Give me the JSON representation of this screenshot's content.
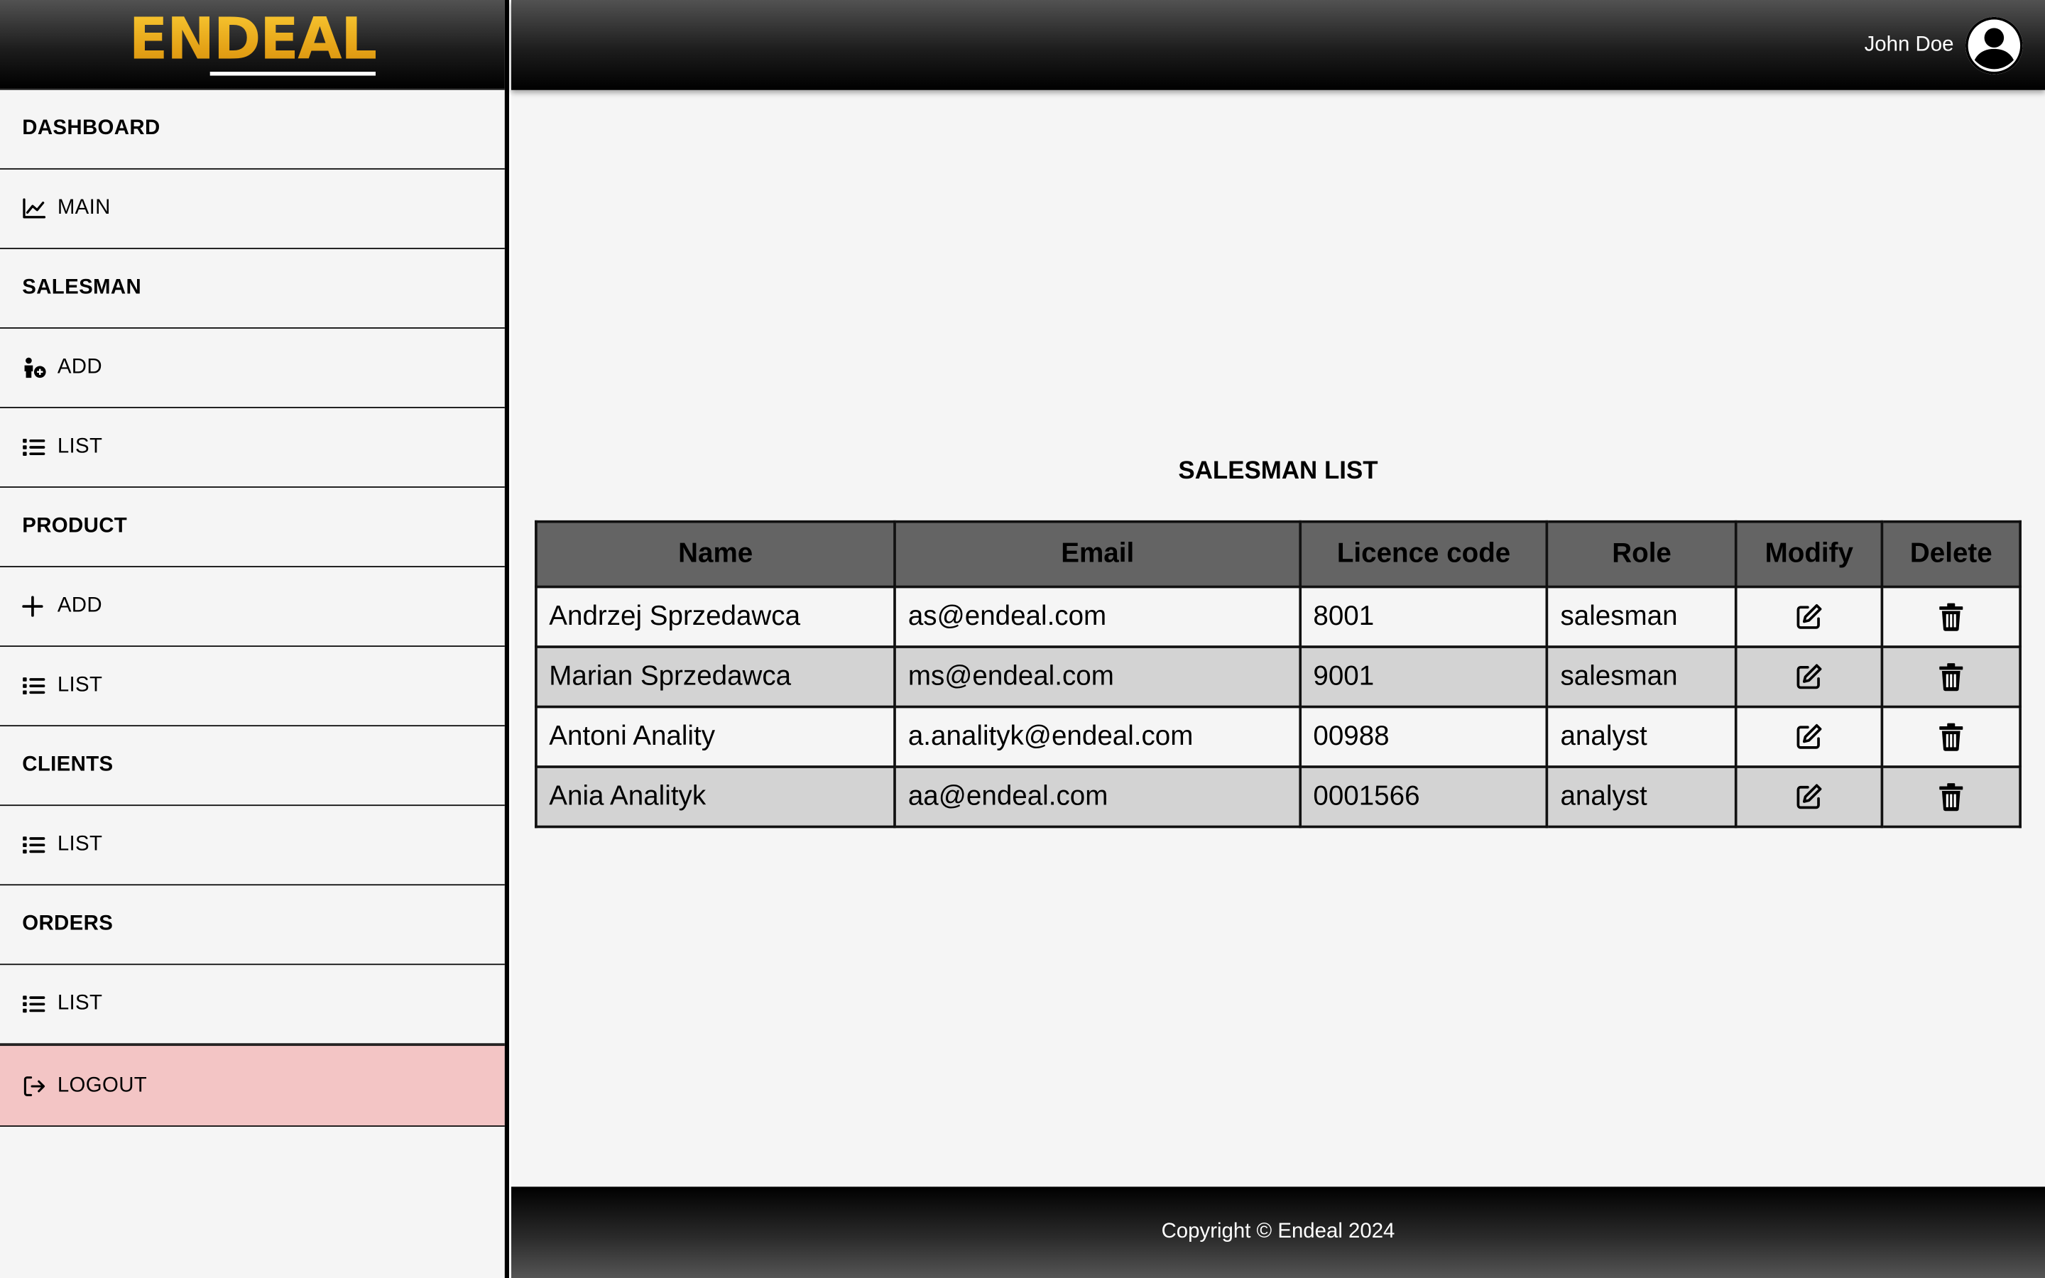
{
  "brand": {
    "logo_text": "ENDEAL"
  },
  "header": {
    "user_name": "John Doe"
  },
  "sidebar": {
    "items": [
      {
        "type": "header",
        "label": "DASHBOARD"
      },
      {
        "type": "link",
        "label": "MAIN",
        "icon": "chart-line-icon"
      },
      {
        "type": "header",
        "label": "SALESMAN"
      },
      {
        "type": "link",
        "label": "ADD",
        "icon": "user-add-icon"
      },
      {
        "type": "link",
        "label": "LIST",
        "icon": "list-icon"
      },
      {
        "type": "header",
        "label": "PRODUCT"
      },
      {
        "type": "link",
        "label": "ADD",
        "icon": "plus-icon"
      },
      {
        "type": "link",
        "label": "LIST",
        "icon": "list-icon"
      },
      {
        "type": "header",
        "label": "CLIENTS"
      },
      {
        "type": "link",
        "label": "LIST",
        "icon": "list-icon"
      },
      {
        "type": "header",
        "label": "ORDERS"
      },
      {
        "type": "link",
        "label": "LIST",
        "icon": "list-icon"
      }
    ],
    "logout_label": "LOGOUT",
    "logout_color": "#f3c5c5"
  },
  "main": {
    "title": "SALESMAN LIST",
    "table": {
      "columns": [
        "Name",
        "Email",
        "Licence code",
        "Role",
        "Modify",
        "Delete"
      ],
      "rows": [
        {
          "name": "Andrzej Sprzedawca",
          "email": "as@endeal.com",
          "licence": "8001",
          "role": "salesman"
        },
        {
          "name": "Marian Sprzedawca",
          "email": "ms@endeal.com",
          "licence": "9001",
          "role": "salesman"
        },
        {
          "name": "Antoni Anality",
          "email": "a.analityk@endeal.com",
          "licence": "00988",
          "role": "analyst"
        },
        {
          "name": "Ania Analityk",
          "email": "aa@endeal.com",
          "licence": "0001566",
          "role": "analyst"
        }
      ]
    }
  },
  "footer": {
    "copyright": "Copyright © Endeal 2024"
  },
  "colors": {
    "brand_gold": "#e8a81a",
    "header_cell": "#646464",
    "row_alt": "#d3d3d3"
  }
}
